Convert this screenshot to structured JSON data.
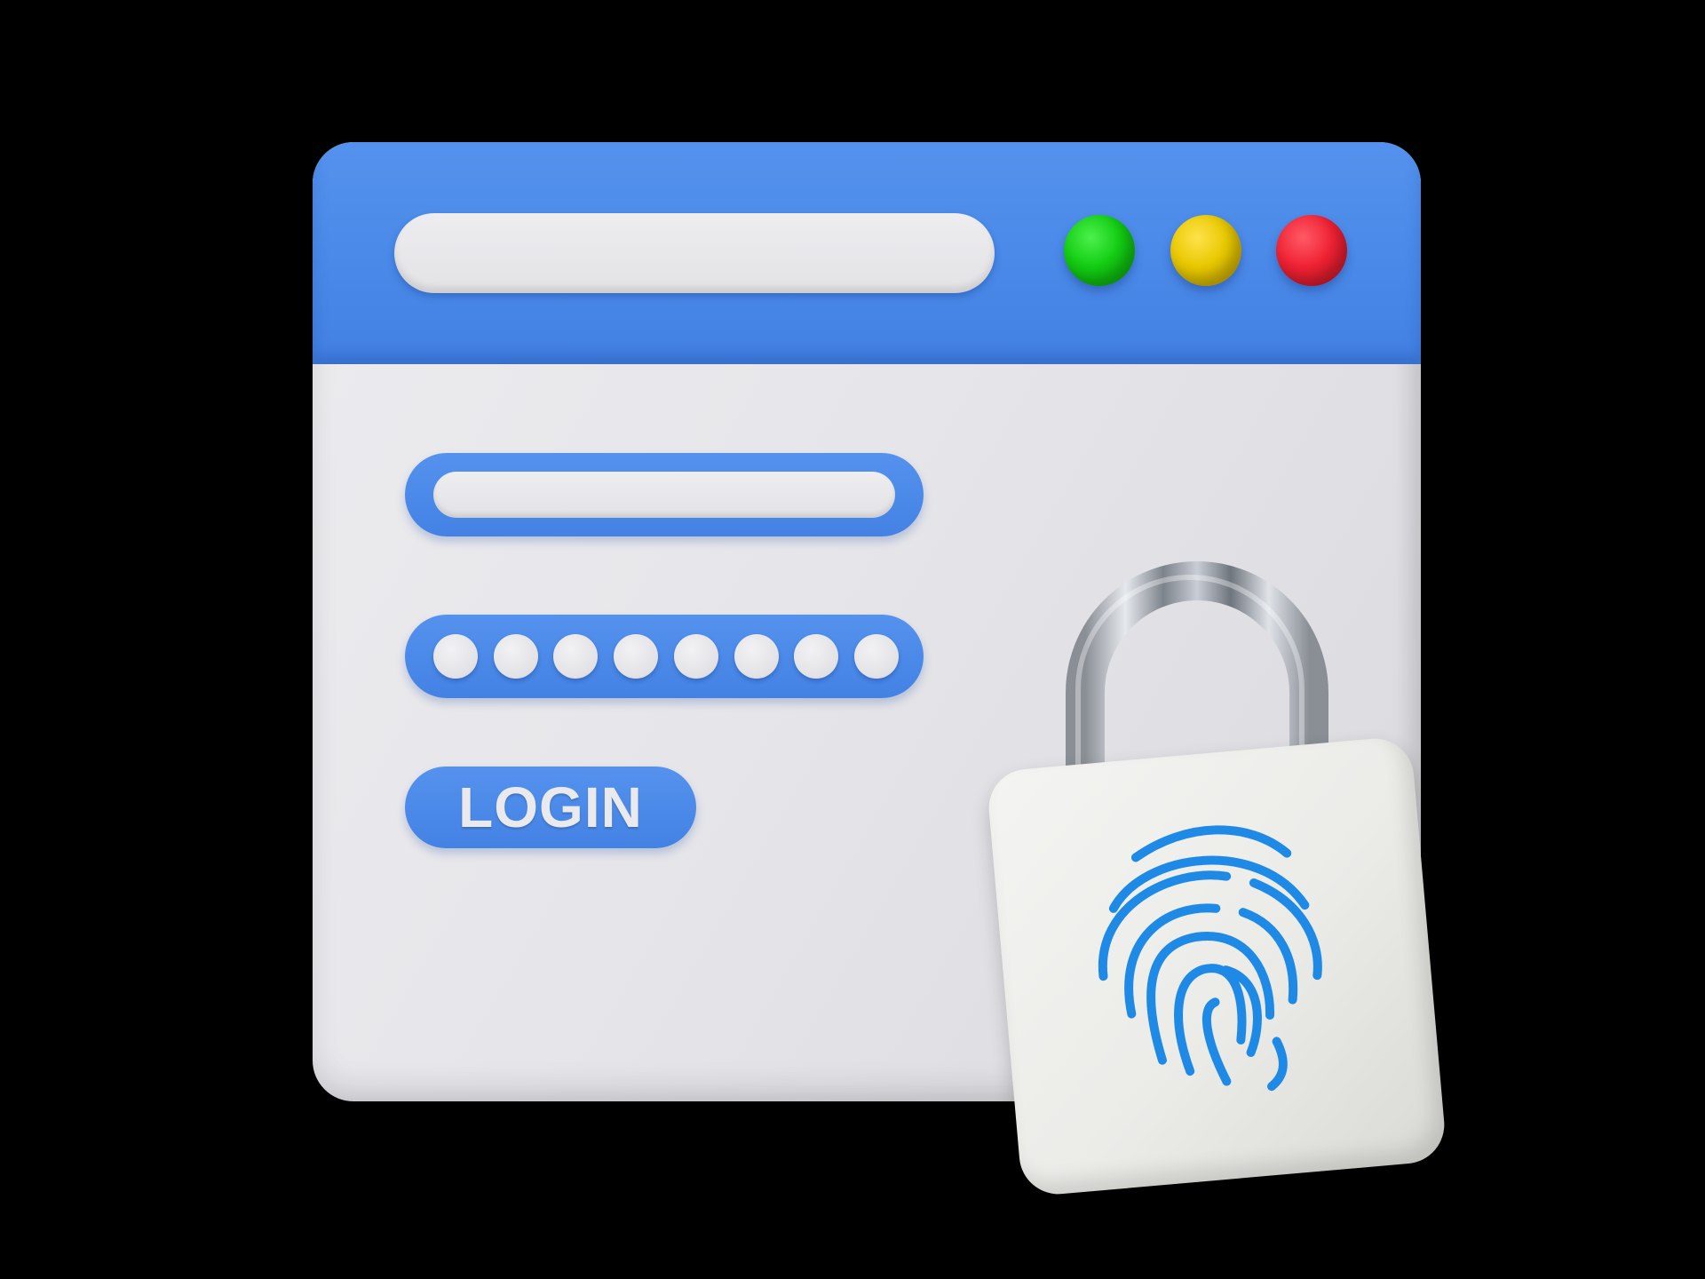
{
  "window": {
    "address_bar": {
      "value": "",
      "placeholder": ""
    },
    "controls": [
      {
        "name": "green",
        "color": "#13cc13"
      },
      {
        "name": "yellow",
        "color": "#e8c800"
      },
      {
        "name": "red",
        "color": "#ef2233"
      }
    ]
  },
  "login_form": {
    "username": {
      "value": "",
      "placeholder": ""
    },
    "password": {
      "masked_dots": 8
    },
    "login_button": {
      "label": "LOGIN"
    }
  },
  "padlock": {
    "icon": "fingerprint-icon",
    "accent": "#1f8ae6"
  },
  "colors": {
    "brand_blue": "#4a89e8",
    "panel": "#e6e6ea",
    "background": "#000000"
  }
}
